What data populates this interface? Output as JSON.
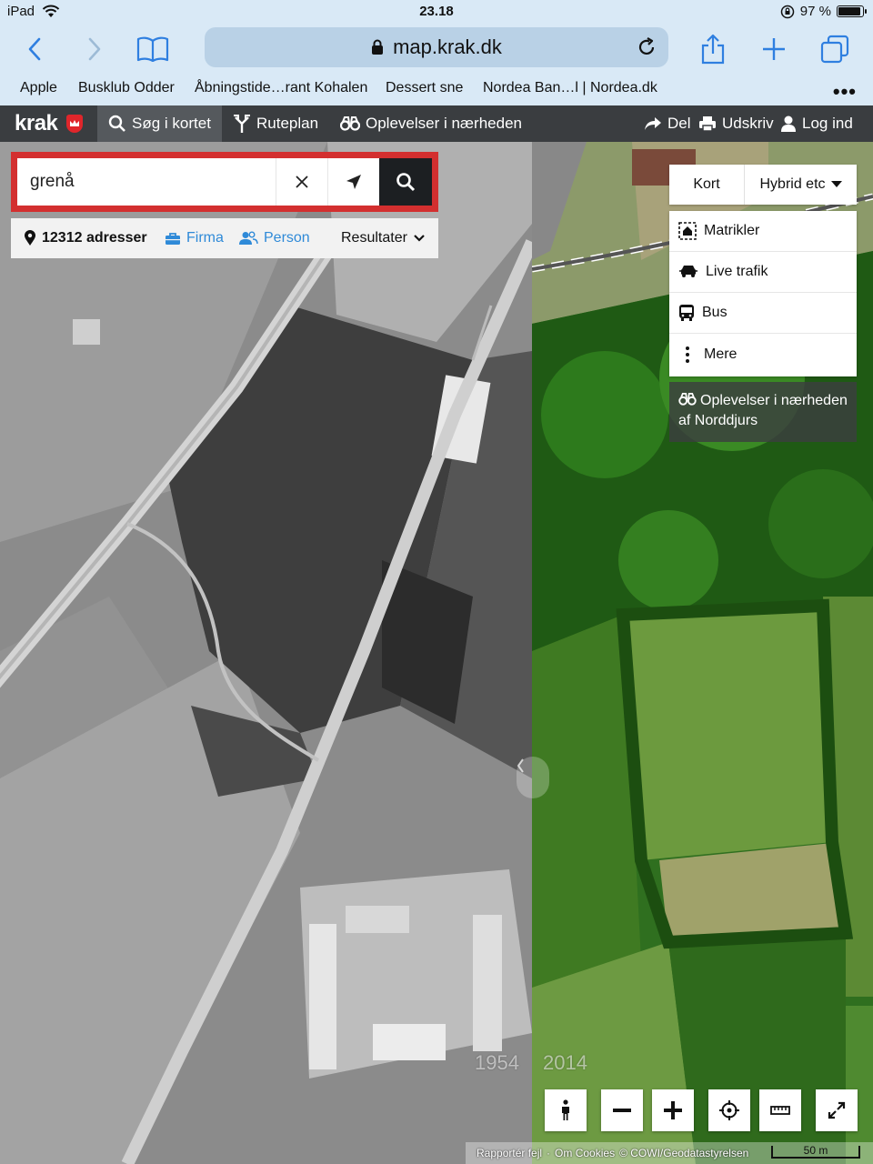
{
  "status_bar": {
    "device": "iPad",
    "time": "23.18",
    "battery": "97 %",
    "battery_fraction": 0.97,
    "icons": [
      "wifi-icon",
      "rotation-lock-icon",
      "battery-icon"
    ]
  },
  "safari": {
    "url": "map.krak.dk",
    "bookmarks": [
      "Apple",
      "Busklub Odder",
      "Åbningstide…rant Kohalen",
      "Dessert sne",
      "Nordea Ban…l | Nordea.dk"
    ],
    "more": "•••"
  },
  "krak_nav": {
    "logo": "krak",
    "items": [
      "Søg i kortet",
      "Ruteplan",
      "Oplevelser i nærheden"
    ],
    "right_items": [
      "Del",
      "Udskriv",
      "Log ind"
    ]
  },
  "search": {
    "value": "grenå",
    "results_count": "12312 adresser",
    "firma": "Firma",
    "person": "Person",
    "results": "Resultater"
  },
  "map_type": {
    "kort": "Kort",
    "hybrid": "Hybrid etc"
  },
  "layers": [
    "Matrikler",
    "Live trafik",
    "Bus",
    "Mere"
  ],
  "nearby": "Oplevelser i nærheden af Norddjurs",
  "years": {
    "old": "1954",
    "new": "2014"
  },
  "attribution": {
    "report": "Rapportér fejl",
    "sep": "·",
    "cookies": "Om Cookies",
    "copyright": "© COWI/Geodatastyrelsen",
    "scale": "50 m"
  },
  "colors": {
    "search_border": "#d32f2f",
    "nav_bg": "#3a3d40",
    "link_blue": "#2f8ad8",
    "safari_bg": "#d9e9f6"
  }
}
